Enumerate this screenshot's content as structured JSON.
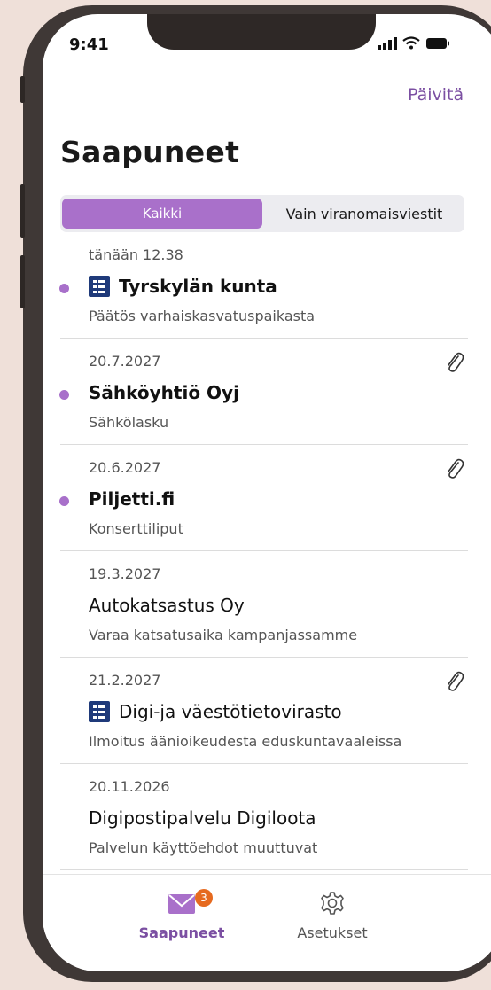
{
  "status": {
    "time": "9:41"
  },
  "header": {
    "refresh_label": "Päivitä",
    "title": "Saapuneet"
  },
  "filter": {
    "all_label": "Kaikki",
    "authority_label": "Vain viranomaisviestit"
  },
  "messages": [
    {
      "date": "tänään 12.38",
      "sender": "Tyrskylän kunta",
      "subject": "Päätös varhaiskasvatuspaikasta",
      "unread": true,
      "authority": true,
      "attachment": false
    },
    {
      "date": "20.7.2027",
      "sender": "Sähköyhtiö Oyj",
      "subject": "Sähkölasku",
      "unread": true,
      "authority": false,
      "attachment": true
    },
    {
      "date": "20.6.2027",
      "sender": "Piljetti.fi",
      "subject": "Konserttiliput",
      "unread": true,
      "authority": false,
      "attachment": true
    },
    {
      "date": "19.3.2027",
      "sender": "Autokatsastus Oy",
      "subject": "Varaa katsatusaika kampanjassamme",
      "unread": false,
      "authority": false,
      "attachment": false
    },
    {
      "date": "21.2.2027",
      "sender": "Digi-ja väestötietovirasto",
      "subject": "Ilmoitus äänioikeudesta eduskuntavaaleissa",
      "unread": false,
      "authority": true,
      "attachment": true
    },
    {
      "date": "20.11.2026",
      "sender": "Digipostipalvelu Digiloota",
      "subject": "Palvelun käyttöehdot muuttuvat",
      "unread": false,
      "authority": false,
      "attachment": false
    }
  ],
  "tabbar": {
    "inbox_label": "Saapuneet",
    "inbox_badge": "3",
    "settings_label": "Asetukset"
  },
  "colors": {
    "accent": "#7b4fa2",
    "segment_active": "#a970ca",
    "unread_dot": "#a870ca",
    "badge": "#e66a1f",
    "authority_icon": "#1f3a7a"
  },
  "icons": {
    "authority": "authority-building-icon",
    "attachment": "paperclip-icon",
    "inbox": "envelope-icon",
    "settings": "gear-icon"
  }
}
